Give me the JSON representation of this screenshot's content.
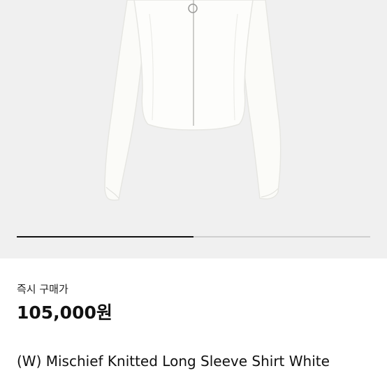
{
  "product": {
    "image_alt": "white knitted zip-up long sleeve shirt",
    "gallery_progress": 0.5,
    "price_label": "즉시 구매가",
    "price": "105,000원",
    "title": "(W) Mischief Knitted Long Sleeve Shirt White"
  },
  "colors": {
    "image_background": "#f0f0f0",
    "garment": "#fbfbf8",
    "progress_fill": "#111111",
    "progress_track": "#cfcfcf"
  }
}
